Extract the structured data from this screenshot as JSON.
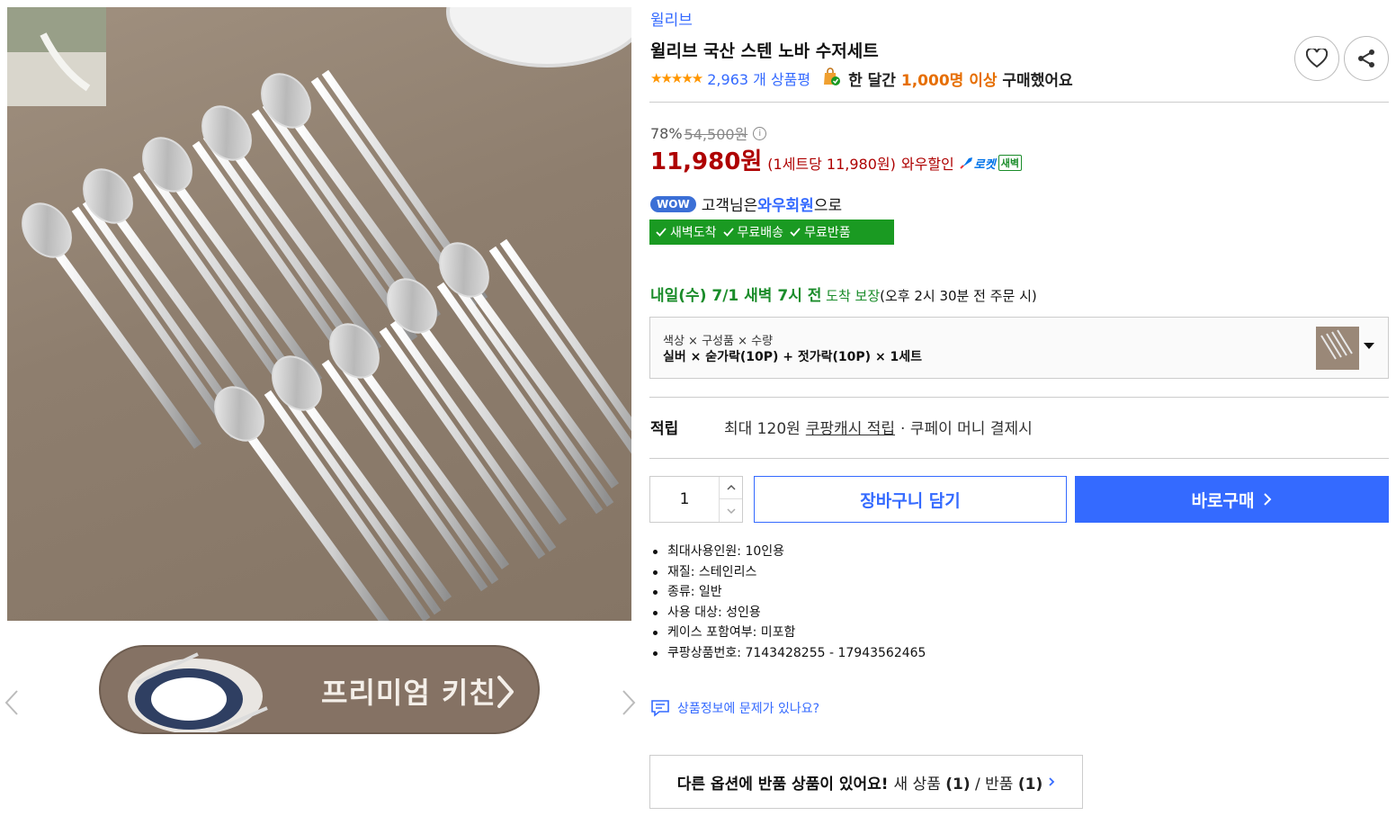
{
  "brand": "윌리브",
  "title": "윌리브 국산 스텐 노바 수저세트",
  "rating": {
    "stars": "★★★★★",
    "review_count": "2,963 개 상품평"
  },
  "purchase": {
    "prefix": "한 달간 ",
    "highlight": "1,000명 이상",
    "suffix": " 구매했어요"
  },
  "price": {
    "discount_rate": "78%",
    "original": "54,500원",
    "sale": "11,980원",
    "unit": "(1세트당 11,980원)",
    "wow_discount": "와우할인",
    "rocket_label": "로켓",
    "rocket_dawn": "새벽"
  },
  "wow": {
    "badge": "WOW",
    "prefix": "고객님은 ",
    "member": "와우회원",
    "suffix": "으로"
  },
  "benefits": [
    "새벽도착",
    "무료배송",
    "무료반품"
  ],
  "delivery": {
    "date": "내일(수) 7/1 새벽 7시 전",
    "guarantee": " 도착 보장",
    "condition": "(오후 2시 30분 전 주문 시)"
  },
  "option": {
    "label": "색상 × 구성품 × 수량",
    "value": "실버 × 숟가락(10P) + 젓가락(10P) × 1세트"
  },
  "points": {
    "label": "적립",
    "prefix": "최대 120원",
    "link": "쿠팡캐시 적립",
    "suffix": "· 쿠페이 머니 결제시"
  },
  "quantity": "1",
  "buttons": {
    "cart": "장바구니 담기",
    "buy": "바로구매"
  },
  "specs": [
    "최대사용인원: 10인용",
    "재질: 스테인리스",
    "종류: 일반",
    "사용 대상: 성인용",
    "케이스 포함여부: 미포함",
    "쿠팡상품번호: 7143428255 - 17943562465"
  ],
  "report_link": "상품정보에 문제가 있나요?",
  "return_notice": {
    "strong": "다른 옵션에 반품 상품이 있어요!",
    "new_label": "새 상품",
    "new_count": "(1)",
    "sep": "/",
    "return_label": "반품",
    "return_count": "(1)"
  },
  "banner_text": "프리미엄 키친",
  "colors": {
    "accent": "#346aff",
    "price": "#ae0000",
    "green": "#1a9a22",
    "star": "#ff9600"
  },
  "icons": [
    "heart-icon",
    "share-icon",
    "info-icon",
    "check-icon",
    "chevron-left-icon",
    "chevron-right-icon",
    "caret-down-icon",
    "report-icon",
    "shopping-bag-icon",
    "rocket-icon"
  ]
}
